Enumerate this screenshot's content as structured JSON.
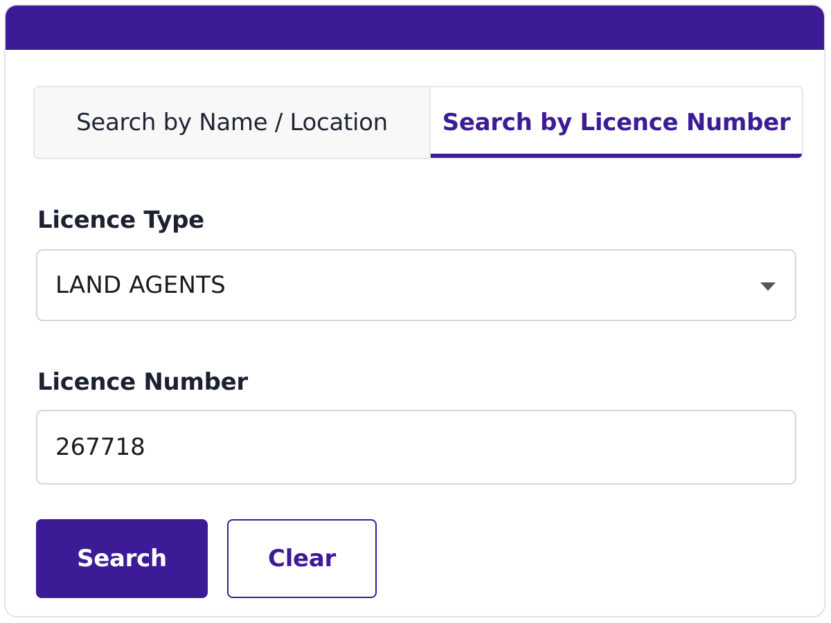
{
  "tabs": {
    "name_location": "Search by Name / Location",
    "licence_number": "Search by Licence Number",
    "active": "licence_number"
  },
  "form": {
    "licence_type_label": "Licence Type",
    "licence_type_value": "LAND AGENTS",
    "licence_number_label": "Licence Number",
    "licence_number_value": "267718"
  },
  "buttons": {
    "search_label": "Search",
    "clear_label": "Clear"
  },
  "colors": {
    "brand": "#3d1b96",
    "border": "#d6d6dc",
    "text": "#1c2130"
  },
  "icons": {
    "dropdown": "chevron-down-icon"
  }
}
